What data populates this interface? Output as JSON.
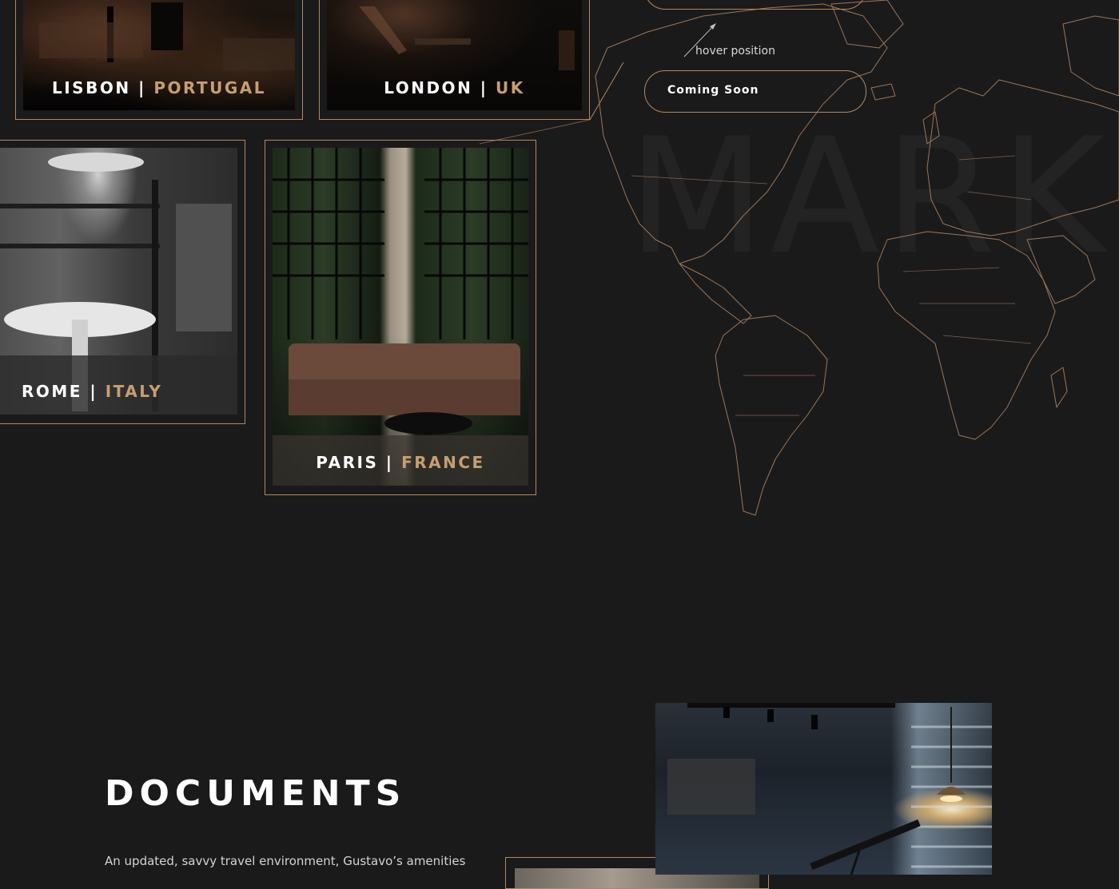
{
  "cities": [
    {
      "id": "lisbon",
      "city": "LISBON",
      "sep": " | ",
      "country": "PORTUGAL"
    },
    {
      "id": "london",
      "city": "LONDON",
      "sep": " | ",
      "country": "UK"
    },
    {
      "id": "rome",
      "city": "ROME",
      "sep": " | ",
      "country": "ITALY"
    },
    {
      "id": "paris",
      "city": "PARIS",
      "sep": " | ",
      "country": "FRANCE"
    }
  ],
  "map": {
    "hover_note": "hover position",
    "coming_soon_label": "Coming Soon",
    "watermark": "MARKI"
  },
  "documents": {
    "title": "DOCUMENTS",
    "text": "An updated, savvy travel environment, Gustavo’s amenities"
  },
  "colors": {
    "accent_gold": "#c79e71",
    "border_gold": "#b4875f",
    "background": "#1a1a1b"
  }
}
